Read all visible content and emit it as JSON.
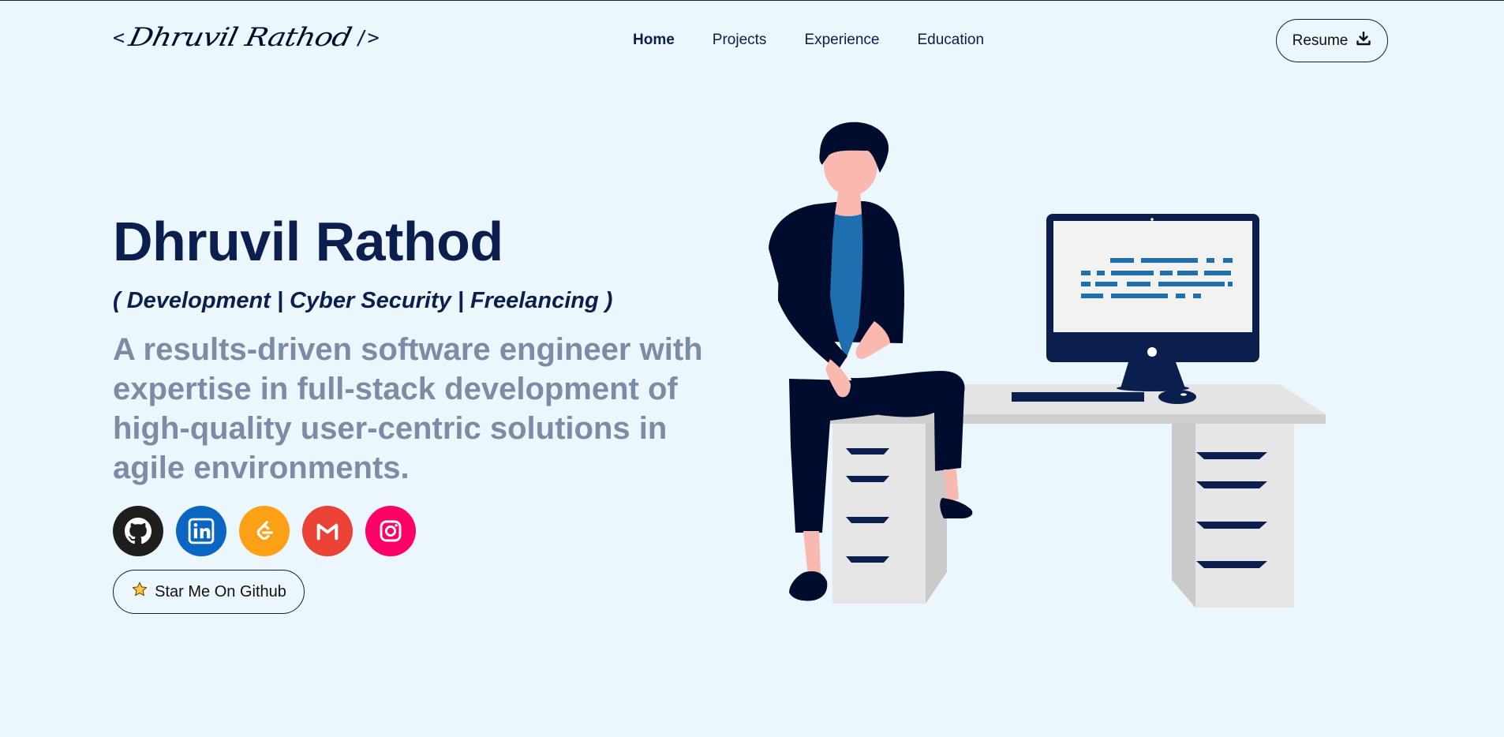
{
  "header": {
    "logo": {
      "open": "<",
      "signature": "Dhruvil Rathod",
      "close": "/>"
    },
    "nav": [
      {
        "label": "Home",
        "active": true
      },
      {
        "label": "Projects",
        "active": false
      },
      {
        "label": "Experience",
        "active": false
      },
      {
        "label": "Education",
        "active": false
      }
    ],
    "resume_label": "Resume",
    "resume_icon": "download-icon"
  },
  "hero": {
    "name": "Dhruvil Rathod",
    "subtitle": "( Development | Cyber Security | Freelancing )",
    "description": "A results-driven software engineer with expertise in full-stack development of high-quality user-centric solutions in agile environments.",
    "socials": [
      {
        "name": "github",
        "icon": "github-icon",
        "color": "#1e1e1e"
      },
      {
        "name": "linkedin",
        "icon": "linkedin-icon",
        "color": "#0a66c2"
      },
      {
        "name": "leetcode",
        "icon": "leetcode-icon",
        "color": "#ffa116"
      },
      {
        "name": "gmail",
        "icon": "gmail-icon",
        "color": "#ea4335"
      },
      {
        "name": "instagram",
        "icon": "instagram-icon",
        "color": "#ff0066"
      }
    ],
    "star_button": "Star Me On Github",
    "star_icon": "star-icon"
  },
  "colors": {
    "background": "#ecf7fd",
    "primary": "#0a1f4e",
    "muted": "#7f8aa6",
    "accent_blue": "#1d6fb0"
  }
}
